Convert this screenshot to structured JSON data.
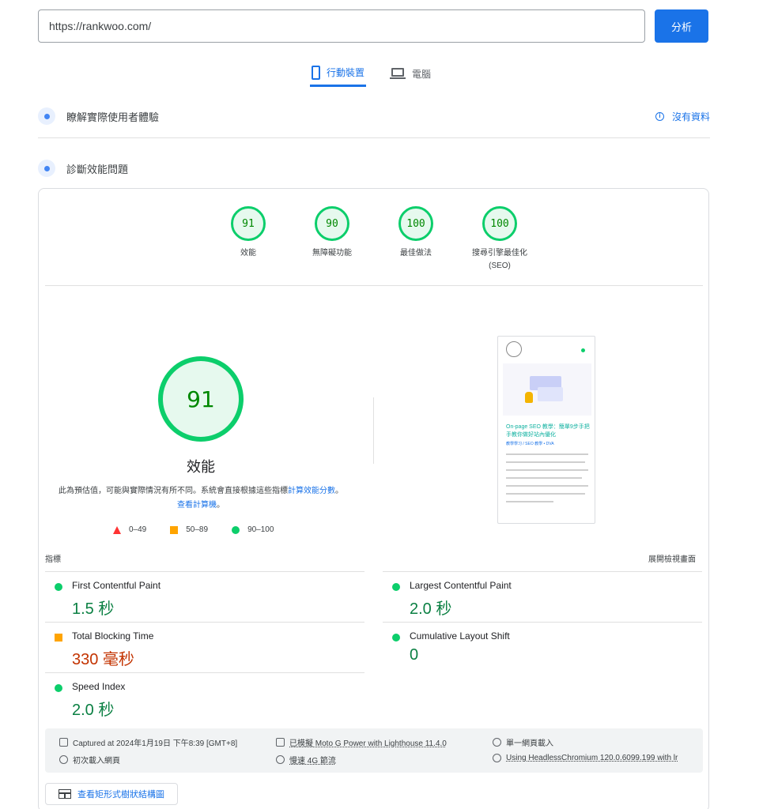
{
  "search": {
    "url": "https://rankwoo.com/",
    "analyze_label": "分析"
  },
  "device_tabs": {
    "mobile": "行動裝置",
    "desktop": "電腦"
  },
  "crux": {
    "title": "瞭解實際使用者體驗",
    "no_data": "沒有資料"
  },
  "diagnose": {
    "title": "診斷效能問題"
  },
  "categories": [
    {
      "score": "91",
      "label": "效能"
    },
    {
      "score": "90",
      "label": "無障礙功能"
    },
    {
      "score": "100",
      "label": "最佳做法"
    },
    {
      "score": "100",
      "label": "搜尋引擎最佳化",
      "label2": "(SEO)"
    }
  ],
  "performance": {
    "score": "91",
    "label": "效能",
    "disclaimer_text": "此為預估值，可能與實際情況有所不同。系統會直接根據這些指標",
    "disclaimer_link": "計算效能分數",
    "disclaimer_sep": "。",
    "calculator_link": "查看計算機",
    "disclaimer_end": "。",
    "legend": {
      "fail": "0–49",
      "average": "50–89",
      "pass": "90–100"
    }
  },
  "screenshot": {
    "title": "On-page SEO 教學：簡單9步手把手教你做好站內優化",
    "subtitle": "教學學习 / SEO 教學 • DVA"
  },
  "metrics_header": {
    "left": "指標",
    "right": "展開檢視畫面"
  },
  "metrics": [
    {
      "name": "First Contentful Paint",
      "value": "1.5 秒",
      "status": "pass"
    },
    {
      "name": "Largest Contentful Paint",
      "value": "2.0 秒",
      "status": "pass"
    },
    {
      "name": "Total Blocking Time",
      "value": "330 毫秒",
      "status": "average"
    },
    {
      "name": "Cumulative Layout Shift",
      "value": "0",
      "status": "pass"
    },
    {
      "name": "Speed Index",
      "value": "2.0 秒",
      "status": "pass"
    }
  ],
  "footer": {
    "captured": "Captured at 2024年1月19日 下午8:39 [GMT+8]",
    "emulated": "已模擬 Moto G Power with Lighthouse 11.4.0",
    "single_page": "單一網頁載入",
    "initial_load": "初次載入網頁",
    "throttling": "慢速 4G 節流",
    "browser": "Using HeadlessChromium 120.0.6099.199 with lr"
  },
  "treemap_label": "查看矩形式樹狀結構圖",
  "colors": {
    "accent": "#1a73e8",
    "pass": "#0cce6b",
    "average": "#ffa400",
    "fail": "#ff3333"
  }
}
